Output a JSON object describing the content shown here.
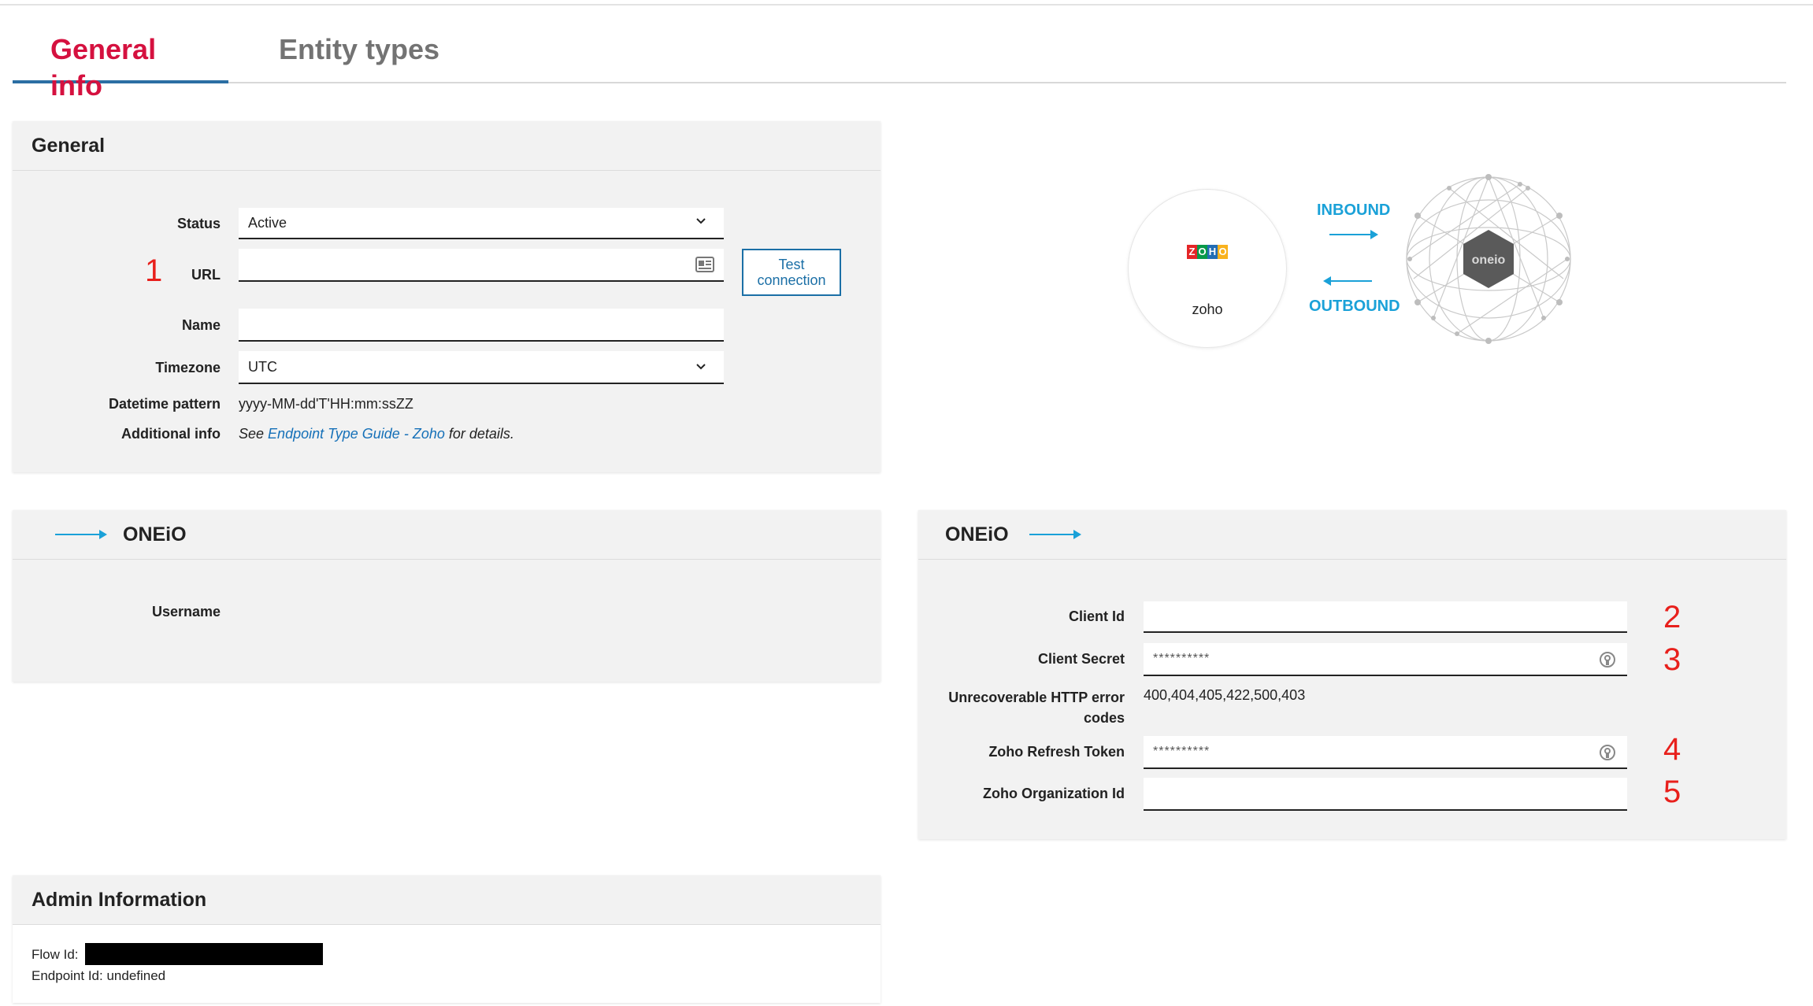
{
  "tabs": [
    {
      "label": "General info",
      "active": true
    },
    {
      "label": "Entity types",
      "active": false
    }
  ],
  "general": {
    "title": "General",
    "status_label": "Status",
    "status_value": "Active",
    "url_label": "URL",
    "url_value": "",
    "test_button_line1": "Test",
    "test_button_line2": "connection",
    "name_label": "Name",
    "name_value": "",
    "timezone_label": "Timezone",
    "timezone_value": "UTC",
    "datetime_label": "Datetime pattern",
    "datetime_value": "yyyy-MM-dd'T'HH:mm:ssZZ",
    "additional_label": "Additional info",
    "additional_see": "See",
    "additional_link": "Endpoint Type Guide - Zoho",
    "additional_tail": "for details."
  },
  "diagram": {
    "zoho_logo_text": "ZOHO",
    "zoho_label": "zoho",
    "inbound": "INBOUND",
    "outbound": "OUTBOUND",
    "oneio_logo_text": "oneio"
  },
  "inbound_panel": {
    "title": "ONEiO",
    "username_label": "Username"
  },
  "outbound_panel": {
    "title": "ONEiO",
    "client_id_label": "Client Id",
    "client_id_value": "",
    "client_secret_label": "Client Secret",
    "client_secret_value": "**********",
    "http_label_line1": "Unrecoverable HTTP error",
    "http_label_line2": "codes",
    "http_value": "400,404,405,422,500,403",
    "refresh_label": "Zoho Refresh Token",
    "refresh_value": "**********",
    "org_label": "Zoho Organization Id",
    "org_value": ""
  },
  "annotations": [
    "1",
    "2",
    "3",
    "4",
    "5"
  ],
  "admin": {
    "title": "Admin Information",
    "flow_label": "Flow Id:",
    "endpoint_text": "Endpoint Id: undefined"
  },
  "colors": {
    "accent_red": "#d5113f",
    "link_blue": "#1570b8",
    "arrow_blue": "#1aa1d8",
    "annotation_red": "#e8201c"
  }
}
